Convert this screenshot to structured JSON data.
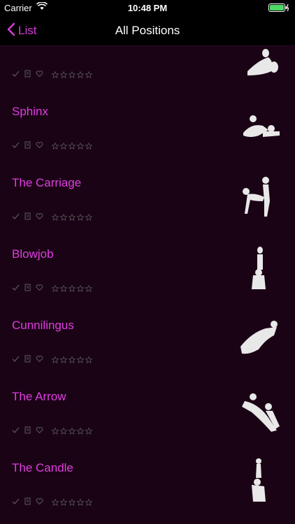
{
  "status": {
    "carrier": "Carrier",
    "time": "10:48 PM"
  },
  "nav": {
    "back_label": "List",
    "title": "All Positions"
  },
  "rows": [
    {
      "title": ""
    },
    {
      "title": "Sphinx"
    },
    {
      "title": "The Carriage"
    },
    {
      "title": "Blowjob"
    },
    {
      "title": "Cunnilingus"
    },
    {
      "title": "The Arrow"
    },
    {
      "title": "The Candle"
    }
  ],
  "colors": {
    "accent": "#df3ee0",
    "background": "#1b0316",
    "bar": "#000000"
  },
  "icons": [
    "check-icon",
    "note-icon",
    "heart-icon",
    "star-icon",
    "chevron-left-icon",
    "wifi-icon",
    "battery-icon"
  ]
}
